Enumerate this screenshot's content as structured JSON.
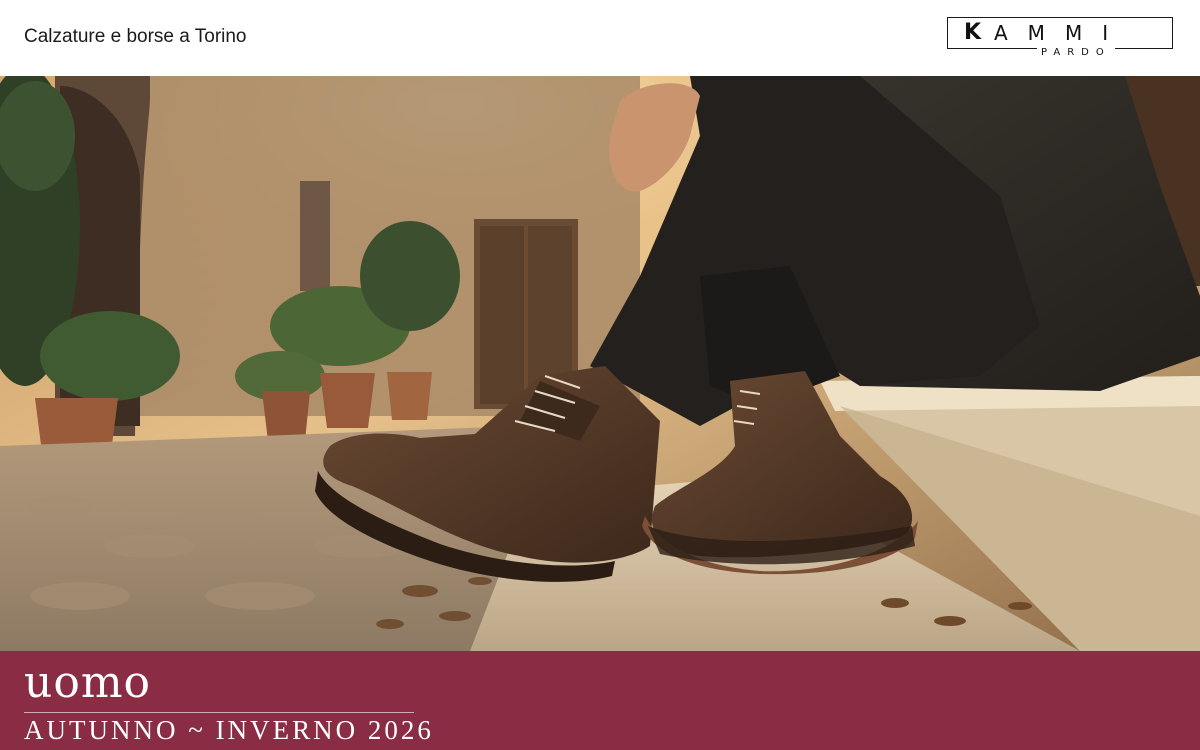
{
  "header": {
    "tagline": "Calzature e borse a Torino",
    "logo": {
      "letter_k": "K",
      "letters": "AMMI",
      "sub": "PARDO"
    }
  },
  "hero": {
    "image_description_icon": "boots-photo-icon"
  },
  "collection": {
    "title": "uomo",
    "season": "AUTUNNO ~ INVERNO 2026"
  },
  "colors": {
    "footer_band": "#8b2c45",
    "header_bg": "#ffffff",
    "text_dark": "#1b1b1b"
  }
}
